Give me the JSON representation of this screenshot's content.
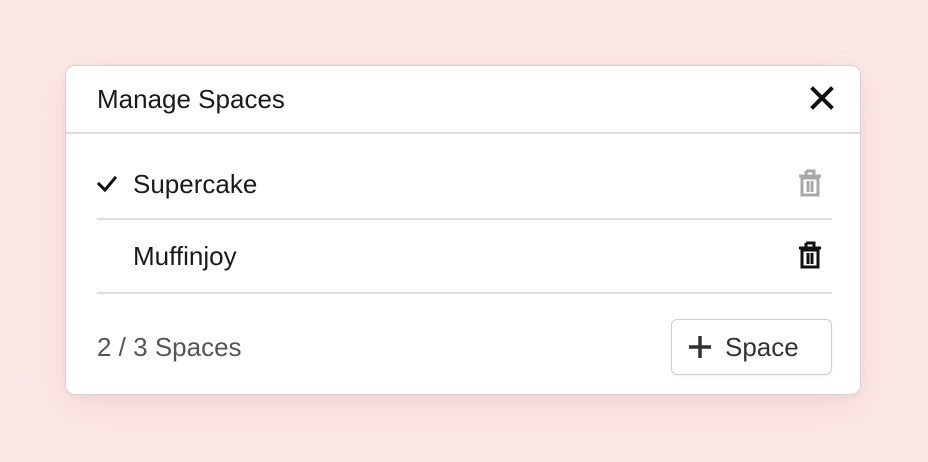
{
  "dialog": {
    "title": "Manage Spaces",
    "close_icon": "close-icon"
  },
  "spaces": [
    {
      "name": "Supercake",
      "selected": true,
      "delete_enabled": false
    },
    {
      "name": "Muffinjoy",
      "selected": false,
      "delete_enabled": true
    }
  ],
  "footer": {
    "count_text": "2 / 3 Spaces",
    "add_button_label": "Space",
    "add_icon": "plus-icon"
  },
  "colors": {
    "background": "#fde8e6",
    "trash_disabled": "#a8a8a8",
    "trash_enabled": "#111111"
  }
}
